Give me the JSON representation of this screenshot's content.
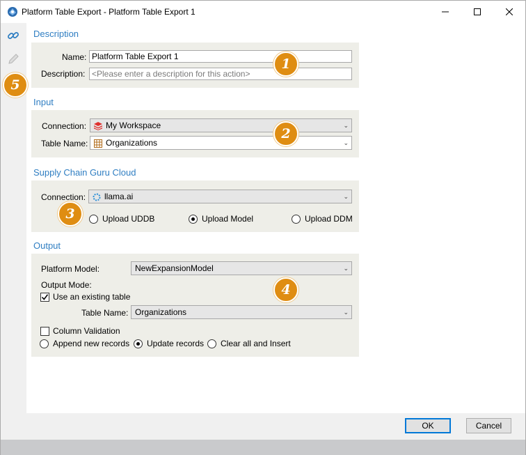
{
  "window": {
    "title": "Platform Table Export - Platform Table Export 1",
    "minimize": "—",
    "maximize": "☐",
    "close": "✕"
  },
  "sidebar": {
    "icons": [
      "link-icon",
      "pencil-icon"
    ]
  },
  "description_section": {
    "title": "Description",
    "name_label": "Name:",
    "name_value": "Platform Table Export 1",
    "description_label": "Description:",
    "description_placeholder": "<Please enter a description for this action>"
  },
  "input_section": {
    "title": "Input",
    "connection_label": "Connection:",
    "connection_value": "My Workspace",
    "table_label": "Table Name:",
    "table_value": "Organizations"
  },
  "cloud_section": {
    "title": "Supply Chain Guru Cloud",
    "connection_label": "Connection:",
    "connection_value": "llama.ai",
    "upload_options": [
      {
        "label": "Upload UDDB",
        "selected": false
      },
      {
        "label": "Upload Model",
        "selected": true
      },
      {
        "label": "Upload DDM",
        "selected": false
      }
    ]
  },
  "output_section": {
    "title": "Output",
    "platform_model_label": "Platform Model:",
    "platform_model_value": "NewExpansionModel",
    "output_mode_label": "Output Mode:",
    "use_existing_label": "Use an existing table",
    "use_existing_checked": true,
    "table_label": "Table Name:",
    "table_value": "Organizations",
    "column_validation_label": "Column Validation",
    "column_validation_checked": false,
    "mode_options": [
      {
        "label": "Append new records",
        "selected": false
      },
      {
        "label": "Update records",
        "selected": true
      },
      {
        "label": "Clear all and Insert",
        "selected": false
      }
    ]
  },
  "callouts": [
    "1",
    "2",
    "3",
    "4",
    "5"
  ],
  "footer": {
    "ok_label": "OK",
    "cancel_label": "Cancel"
  },
  "colors": {
    "section_title": "#2f7ec2",
    "panel_bg": "#eeeee8",
    "callout": "#df8d12"
  }
}
